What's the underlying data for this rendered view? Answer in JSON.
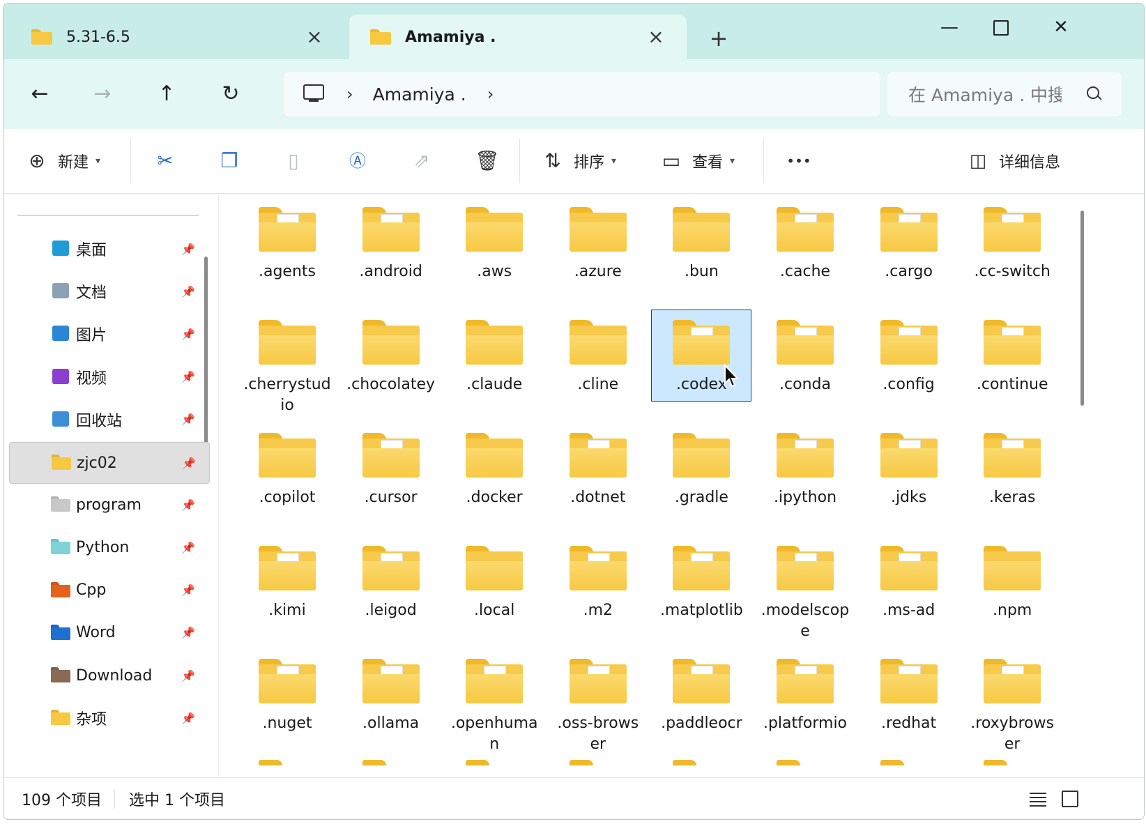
{
  "tabs": [
    {
      "label": "5.31-6.5",
      "active": false
    },
    {
      "label": "Amamiya .",
      "active": true
    }
  ],
  "window_controls": {
    "minimize": "—",
    "maximize": "□",
    "close": "✕"
  },
  "nav": {
    "back": "←",
    "forward": "→",
    "up": "↑",
    "refresh": "↻",
    "breadcrumb": [
      "Amamiya ."
    ],
    "search_placeholder": "在 Amamiya . 中搜索"
  },
  "commands": {
    "new": "新建",
    "sort": "排序",
    "view": "查看",
    "more": "•••",
    "details": "详细信息"
  },
  "sidebar": {
    "items": [
      {
        "label": "桌面",
        "icon": "desktop-icon",
        "color": "#1f9bd6"
      },
      {
        "label": "文档",
        "icon": "documents-icon",
        "color": "#8aa1b6"
      },
      {
        "label": "图片",
        "icon": "pictures-icon",
        "color": "#2b86d6"
      },
      {
        "label": "视频",
        "icon": "videos-icon",
        "color": "#8a3fd1"
      },
      {
        "label": "回收站",
        "icon": "recycle-bin-icon",
        "color": "#3c8fd6"
      },
      {
        "label": "zjc02",
        "icon": "folder-icon",
        "color": "#f7c943"
      },
      {
        "label": "program",
        "icon": "folder-icon",
        "color": "#c8c8c8"
      },
      {
        "label": "Python",
        "icon": "folder-icon",
        "color": "#7fd3d8"
      },
      {
        "label": "Cpp",
        "icon": "folder-icon",
        "color": "#e5621a"
      },
      {
        "label": "Word",
        "icon": "folder-icon",
        "color": "#1f6fd1"
      },
      {
        "label": "Download",
        "icon": "folder-icon",
        "color": "#8a6a55"
      },
      {
        "label": "杂项",
        "icon": "folder-icon",
        "color": "#f7c943"
      }
    ]
  },
  "files": [
    {
      "name": ".agents",
      "overlay": "code"
    },
    {
      "name": ".android",
      "overlay": "doc"
    },
    {
      "name": ".aws",
      "overlay": "none"
    },
    {
      "name": ".azure",
      "overlay": "none"
    },
    {
      "name": ".bun",
      "overlay": "none"
    },
    {
      "name": ".cache",
      "overlay": "doc"
    },
    {
      "name": ".cargo",
      "overlay": "doc"
    },
    {
      "name": ".cc-switch",
      "overlay": "image"
    },
    {
      "name": ".cherrystudio",
      "overlay": "none"
    },
    {
      "name": ".chocolatey",
      "overlay": "none"
    },
    {
      "name": ".claude",
      "overlay": "none"
    },
    {
      "name": ".cline",
      "overlay": "none"
    },
    {
      "name": ".codex",
      "overlay": "doc"
    },
    {
      "name": ".conda",
      "overlay": "doc"
    },
    {
      "name": ".config",
      "overlay": "doc"
    },
    {
      "name": ".continue",
      "overlay": "doc"
    },
    {
      "name": ".copilot",
      "overlay": "none"
    },
    {
      "name": ".cursor",
      "overlay": "doc"
    },
    {
      "name": ".docker",
      "overlay": "none"
    },
    {
      "name": ".dotnet",
      "overlay": "doc"
    },
    {
      "name": ".gradle",
      "overlay": "none"
    },
    {
      "name": ".ipython",
      "overlay": "doc"
    },
    {
      "name": ".jdks",
      "overlay": "doc"
    },
    {
      "name": ".keras",
      "overlay": "doc"
    },
    {
      "name": ".kimi",
      "overlay": "code"
    },
    {
      "name": ".leigod",
      "overlay": "doc"
    },
    {
      "name": ".local",
      "overlay": "none"
    },
    {
      "name": ".m2",
      "overlay": "doc"
    },
    {
      "name": ".matplotlib",
      "overlay": "code"
    },
    {
      "name": ".modelscope",
      "overlay": "doc"
    },
    {
      "name": ".ms-ad",
      "overlay": "doc"
    },
    {
      "name": ".npm",
      "overlay": "none"
    },
    {
      "name": ".nuget",
      "overlay": "doc"
    },
    {
      "name": ".ollama",
      "overlay": "doc"
    },
    {
      "name": ".openhuman",
      "overlay": "doc"
    },
    {
      "name": ".oss-browser",
      "overlay": "doc"
    },
    {
      "name": ".paddleocr",
      "overlay": "doc"
    },
    {
      "name": ".platformio",
      "overlay": "doc"
    },
    {
      "name": ".redhat",
      "overlay": "doc"
    },
    {
      "name": ".roxybrowser",
      "overlay": "code"
    }
  ],
  "selected_file": ".codex",
  "status": {
    "count": "109 个项目",
    "selection": "选中 1 个项目"
  },
  "colors": {
    "tabstrip": "#c8ece8",
    "navbar": "#e3f7f4",
    "selection": "#cce8ff",
    "folder": "#f7c943"
  }
}
